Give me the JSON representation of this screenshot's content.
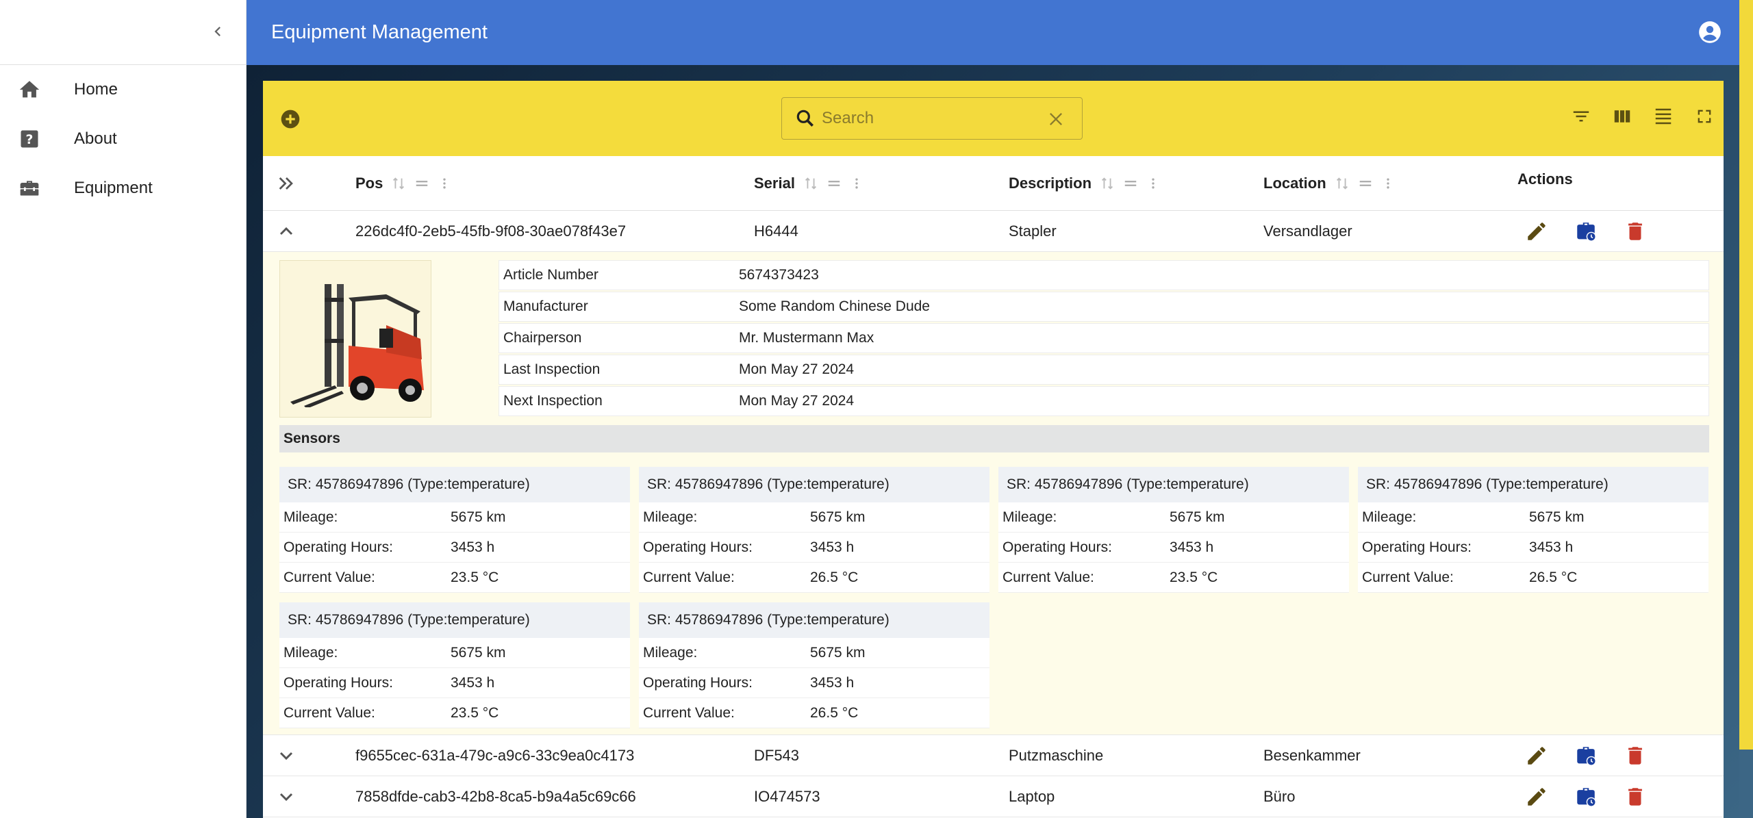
{
  "app": {
    "title": "Equipment Management"
  },
  "sidebar": {
    "items": [
      {
        "label": "Home",
        "icon": "home-icon"
      },
      {
        "label": "About",
        "icon": "help-icon"
      },
      {
        "label": "Equipment",
        "icon": "toolbox-icon"
      }
    ]
  },
  "search": {
    "placeholder": "Search",
    "value": ""
  },
  "columns": {
    "pos": "Pos",
    "serial": "Serial",
    "description": "Description",
    "location": "Location",
    "actions": "Actions"
  },
  "rows": [
    {
      "pos": "226dc4f0-2eb5-45fb-9f08-30ae078f43e7",
      "serial": "H6444",
      "description": "Stapler",
      "location": "Versandlager",
      "expanded": true
    },
    {
      "pos": "f9655cec-631a-479c-a9c6-33c9ea0c4173",
      "serial": "DF543",
      "description": "Putzmaschine",
      "location": "Besenkammer",
      "expanded": false
    },
    {
      "pos": "7858dfde-cab3-42b8-8ca5-b9a4a5c69c66",
      "serial": "IO474573",
      "description": "Laptop",
      "location": "Büro",
      "expanded": false
    }
  ],
  "detail": {
    "info": [
      {
        "label": "Article Number",
        "value": "5674373423"
      },
      {
        "label": "Manufacturer",
        "value": "Some Random Chinese Dude"
      },
      {
        "label": "Chairperson",
        "value": "Mr. Mustermann Max"
      },
      {
        "label": "Last Inspection",
        "value": "Mon May 27 2024"
      },
      {
        "label": "Next Inspection",
        "value": "Mon May 27 2024"
      }
    ],
    "sensors_title": "Sensors",
    "sensor_labels": {
      "mileage": "Mileage:",
      "hours": "Operating Hours:",
      "current": "Current Value:"
    },
    "sensors": [
      {
        "title": "SR: 45786947896 (Type:temperature)",
        "mileage": "5675 km",
        "hours": "3453 h",
        "current": "23.5 °C"
      },
      {
        "title": "SR: 45786947896 (Type:temperature)",
        "mileage": "5675 km",
        "hours": "3453 h",
        "current": "26.5 °C"
      },
      {
        "title": "SR: 45786947896 (Type:temperature)",
        "mileage": "5675 km",
        "hours": "3453 h",
        "current": "23.5 °C"
      },
      {
        "title": "SR: 45786947896 (Type:temperature)",
        "mileage": "5675 km",
        "hours": "3453 h",
        "current": "26.5 °C"
      },
      {
        "title": "SR: 45786947896 (Type:temperature)",
        "mileage": "5675 km",
        "hours": "3453 h",
        "current": "23.5 °C"
      },
      {
        "title": "SR: 45786947896 (Type:temperature)",
        "mileage": "5675 km",
        "hours": "3453 h",
        "current": "26.5 °C"
      }
    ]
  },
  "colors": {
    "appbar": "#4275d1",
    "toolbar": "#f4dc3c",
    "edit": "#5a4a12",
    "inspect": "#1a3fa0",
    "delete": "#c93a2c"
  }
}
